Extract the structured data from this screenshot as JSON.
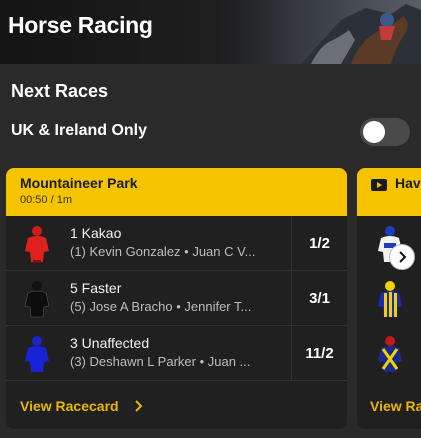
{
  "header": {
    "title": "Horse Racing"
  },
  "section": {
    "title": "Next Races"
  },
  "filter": {
    "label": "UK & Ireland Only",
    "enabled": false
  },
  "races": [
    {
      "meeting": "Mountaineer Park",
      "time_distance": "00:50 / 1m",
      "runners": [
        {
          "name": "1 Kakao",
          "people": "(1) Kevin Gonzalez • Juan C V...",
          "odds": "1/2",
          "silk": "red-silk-icon"
        },
        {
          "name": "5 Faster",
          "people": "(5) Jose A Bracho • Jennifer T...",
          "odds": "3/1",
          "silk": "black-silk-icon"
        },
        {
          "name": "3 Unaffected",
          "people": "(3) Deshawn L Parker • Juan ...",
          "odds": "11/2",
          "silk": "blue-silk-icon"
        }
      ],
      "view_link": "View Racecard"
    },
    {
      "meeting": "Hav",
      "live_icon": "tv-play-icon",
      "silks": [
        "white-blue-silk-icon",
        "blue-yellow-stripe-silk-icon",
        "navy-yellow-cross-silk-icon"
      ],
      "view_link": "View Ra"
    }
  ],
  "colors": {
    "accent": "#f5c400",
    "panel": "#2a2a2a",
    "card": "#202020"
  }
}
